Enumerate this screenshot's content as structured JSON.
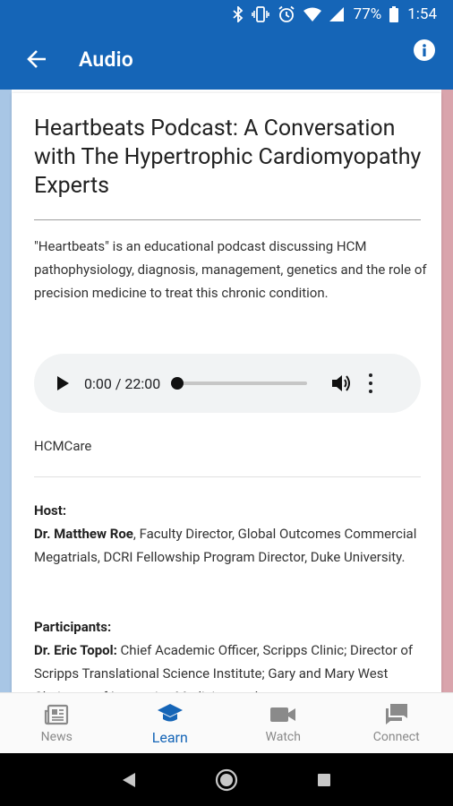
{
  "status_bar": {
    "battery": "77%",
    "time": "1:54",
    "icons": [
      "bluetooth-icon",
      "vibrate-icon",
      "alarm-icon",
      "wifi-icon",
      "signal-icon",
      "battery-icon"
    ]
  },
  "app_bar": {
    "title": "Audio",
    "back_icon": "arrow-left-icon",
    "info_icon": "info-icon"
  },
  "article": {
    "title": "Heartbeats Podcast: A Conversation with The Hypertrophic Cardiomyopathy Experts",
    "description": "\"Heartbeats\" is an educational podcast discussing HCM pathophysiology, diagnosis, management, genetics and the role of precision medicine to treat this chronic condition.",
    "audio": {
      "time_display": "0:00 / 22:00",
      "progress": 0.0
    },
    "source": "HCMCare",
    "host": {
      "heading": "Host:",
      "name": "Dr. Matthew Roe",
      "details": ", Faculty Director, Global Outcomes Commercial Megatrials, DCRI Fellowship Program Director, Duke University."
    },
    "participants": {
      "heading": "Participants:",
      "name": "Dr. Eric Topol:",
      "details": " Chief Academic Officer, Scripps Clinic; Director of Scripps Translational Science Institute; Gary and Mary West Chairman of Innovative Medicine; and"
    }
  },
  "bottom_nav": {
    "items": [
      {
        "label": "News",
        "icon": "newspaper-icon",
        "active": false
      },
      {
        "label": "Learn",
        "icon": "graduation-cap-icon",
        "active": true
      },
      {
        "label": "Watch",
        "icon": "video-camera-icon",
        "active": false
      },
      {
        "label": "Connect",
        "icon": "chat-bubbles-icon",
        "active": false
      }
    ]
  },
  "colors": {
    "primary": "#1565b7",
    "left_stripe": "#a8c6e5",
    "right_stripe": "#d9a4ac"
  }
}
